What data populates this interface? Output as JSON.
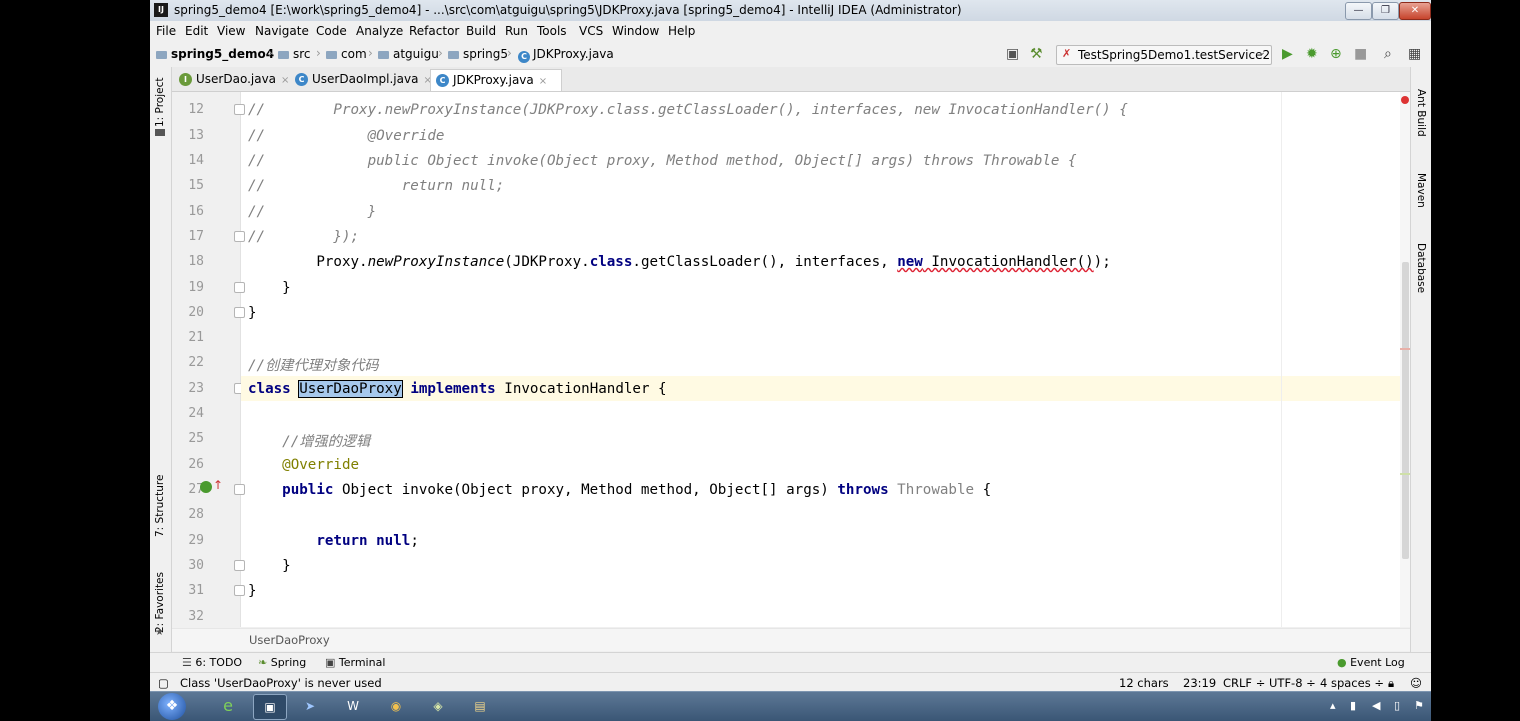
{
  "window": {
    "title": "spring5_demo4 [E:\\work\\spring5_demo4] - ...\\src\\com\\atguigu\\spring5\\JDKProxy.java [spring5_demo4] - IntelliJ IDEA (Administrator)",
    "controls": {
      "minimize": "—",
      "maximize": "❐",
      "close": "✕"
    }
  },
  "menu": [
    "File",
    "Edit",
    "View",
    "Navigate",
    "Code",
    "Analyze",
    "Refactor",
    "Build",
    "Run",
    "Tools",
    "VCS",
    "Window",
    "Help"
  ],
  "breadcrumb": [
    "spring5_demo4",
    "src",
    "com",
    "atguigu",
    "spring5",
    "JDKProxy.java"
  ],
  "run_config": "TestSpring5Demo1.testService2",
  "tabs": [
    {
      "label": "UserDao.java",
      "icon": "I",
      "active": false
    },
    {
      "label": "UserDaoImpl.java",
      "icon": "C",
      "active": false
    },
    {
      "label": "JDKProxy.java",
      "icon": "C",
      "active": true
    }
  ],
  "left_tools": [
    "1: Project",
    "7: Structure",
    "2: Favorites"
  ],
  "right_tools": [
    "Ant Build",
    "Maven",
    "Database"
  ],
  "editor": {
    "line_numbers": [
      "12",
      "13",
      "14",
      "15",
      "16",
      "17",
      "18",
      "19",
      "20",
      "21",
      "22",
      "23",
      "24",
      "25",
      "26",
      "27",
      "28",
      "29",
      "30",
      "31",
      "32"
    ],
    "lines": [
      {
        "c": "//",
        "a": "        Proxy.newProxyInstance(JDKProxy.class.getClassLoader(), interfaces, new InvocationHandler() {"
      },
      {
        "c": "//",
        "a": "            @Override"
      },
      {
        "c": "//",
        "a": "            public Object invoke(Object proxy, Method method, Object[] args) throws Throwable {"
      },
      {
        "c": "//",
        "a": "                return null;"
      },
      {
        "c": "//",
        "a": "            }"
      },
      {
        "c": "//",
        "a": "        });"
      },
      {
        "l18a": "        Proxy.",
        "l18b": "newProxyInstance",
        "l18c": "(JDKProxy.",
        "l18d": "class",
        "l18e": ".getClassLoader(), interfaces, ",
        "l18f": "new",
        "l18g": " InvocationHandler()",
        "l18h": ");"
      },
      {
        "t": "    }"
      },
      {
        "t": "}"
      },
      {
        "t": ""
      },
      {
        "cm": "//创建代理对象代码"
      },
      {
        "k1": "class",
        "sel": "UserDaoProxy",
        "k2": "implements",
        "rest": " InvocationHandler {"
      },
      {
        "t": ""
      },
      {
        "cm": "    //增强的逻辑"
      },
      {
        "an": "    @Override"
      },
      {
        "p1": "public",
        "p2": " Object invoke(Object proxy, Method method, Object[] args) ",
        "p3": "throws",
        "p4": " Throwable",
        "p5": " {"
      },
      {
        "t": ""
      },
      {
        "r1": "return",
        "r2": " null",
        "r3": ";"
      },
      {
        "t": "    }"
      },
      {
        "t": "}"
      },
      {
        "t": ""
      }
    ],
    "breadcrumb_footer": "UserDaoProxy"
  },
  "bottom_tools": [
    {
      "label": "6: TODO",
      "icon": "list-icon"
    },
    {
      "label": "Spring",
      "icon": "leaf-icon"
    },
    {
      "label": "Terminal",
      "icon": "terminal-icon"
    }
  ],
  "event_log": "Event Log",
  "status": {
    "message": "Class 'UserDaoProxy' is never used",
    "chars": "12 chars",
    "position": "23:19",
    "line_sep": "CRLF ÷",
    "encoding": "UTF-8 ÷",
    "indent": "4 spaces ÷"
  },
  "taskbar": {
    "start_icon": "windows-start-icon"
  },
  "colors": {
    "keyword": "#000080",
    "comment": "#808080",
    "annotation": "#808000",
    "selection": "#a6c8ec",
    "current_line": "#fffae3"
  }
}
